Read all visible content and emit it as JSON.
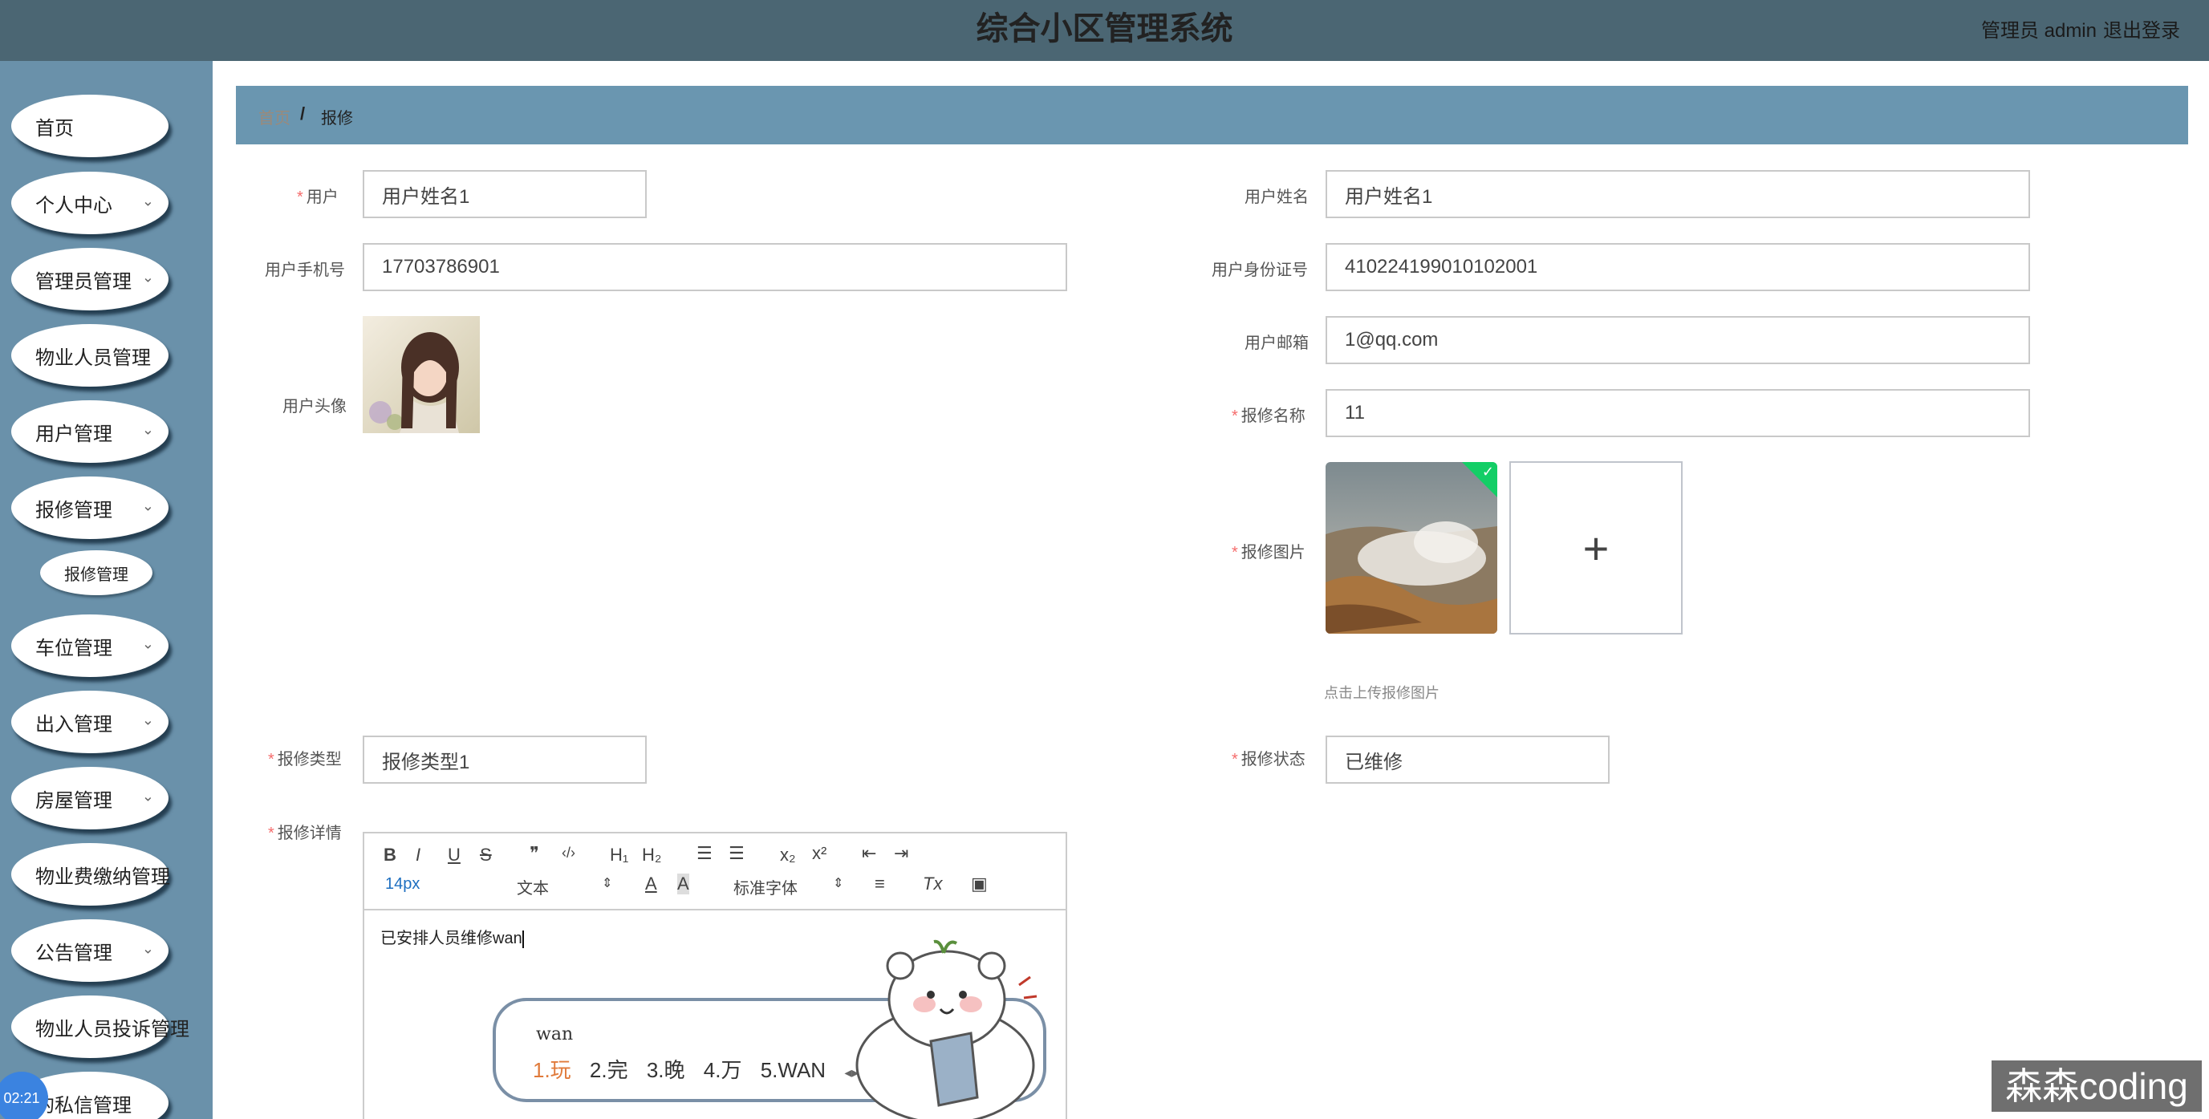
{
  "header": {
    "title": "综合小区管理系统",
    "user_label": "管理员 admin",
    "logout_label": "退出登录"
  },
  "sidebar": {
    "items": [
      {
        "label": "首页",
        "has_sub": false
      },
      {
        "label": "个人中心",
        "has_sub": true
      },
      {
        "label": "管理员管理",
        "has_sub": true
      },
      {
        "label": "物业人员管理",
        "has_sub": false
      },
      {
        "label": "用户管理",
        "has_sub": true
      },
      {
        "label": "报修管理",
        "has_sub": true
      },
      {
        "label": "车位管理",
        "has_sub": true
      },
      {
        "label": "出入管理",
        "has_sub": true
      },
      {
        "label": "房屋管理",
        "has_sub": true
      },
      {
        "label": "物业费缴纳管理",
        "has_sub": false
      },
      {
        "label": "公告管理",
        "has_sub": true
      },
      {
        "label": "物业人员投诉管理",
        "has_sub": false
      },
      {
        "label": "的私信管理",
        "has_sub": false
      }
    ],
    "sub_item": "报修管理",
    "chevron": "⌄",
    "clock": "02:21"
  },
  "breadcrumb": {
    "home": "首页",
    "separator": "/",
    "current": "报修"
  },
  "form": {
    "user": {
      "label": "用户",
      "value": "用户姓名1"
    },
    "user_name": {
      "label": "用户姓名",
      "value": "用户姓名1"
    },
    "phone": {
      "label": "用户手机号",
      "value": "17703786901"
    },
    "id_card": {
      "label": "用户身份证号",
      "value": "410224199010102001"
    },
    "avatar": {
      "label": "用户头像"
    },
    "email": {
      "label": "用户邮箱",
      "value": "1@qq.com"
    },
    "repair_name": {
      "label": "报修名称",
      "value": "11"
    },
    "repair_image": {
      "label": "报修图片",
      "hint": "点击上传报修图片",
      "add": "+"
    },
    "repair_type": {
      "label": "报修类型",
      "value": "报修类型1"
    },
    "repair_status": {
      "label": "报修状态",
      "value": "已维修"
    },
    "repair_detail": {
      "label": "报修详情"
    }
  },
  "editor": {
    "toolbar": {
      "bold": "B",
      "italic": "I",
      "underline": "U",
      "strike": "S",
      "quote": "❞",
      "code": "‹/›",
      "h1": "H₁",
      "h2": "H₂",
      "ordered": "☰",
      "bullet": "☰",
      "sub": "x₂",
      "sup": "x²",
      "outdent": "⇤",
      "indent": "⇥",
      "size": "14px",
      "format": "文本",
      "format_arrow": "⇕",
      "color": "A",
      "bg": "A",
      "font": "标准字体",
      "font_arrow": "⇕",
      "align": "≡",
      "clear": "Tx",
      "image": "▣"
    },
    "content": "已安排人员维修wan"
  },
  "ime": {
    "input": "wan",
    "candidates": [
      "1.玩",
      "2.完",
      "3.晚",
      "4.万",
      "5.WAN"
    ],
    "nav": "◂▸"
  },
  "watermark": "森森coding"
}
